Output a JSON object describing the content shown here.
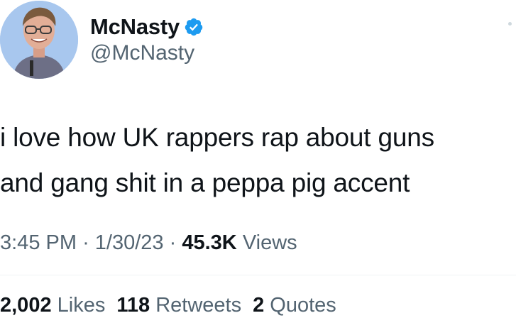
{
  "author": {
    "display_name": "McNasty",
    "handle": "@McNasty",
    "verified": true,
    "verified_color": "#1d9bf0"
  },
  "tweet": {
    "text": "i love how UK rappers rap about guns\nand gang shit in a peppa pig accent"
  },
  "meta": {
    "time": "3:45 PM",
    "separator": "·",
    "date": "1/30/23",
    "views_count": "45.3K",
    "views_label": "Views"
  },
  "stats": {
    "likes_count": "2,002",
    "likes_label": "Likes",
    "retweets_count": "118",
    "retweets_label": "Retweets",
    "quotes_count": "2",
    "quotes_label": "Quotes"
  },
  "icons": {
    "verified": "verified-badge-icon",
    "more": "more-options-icon"
  }
}
